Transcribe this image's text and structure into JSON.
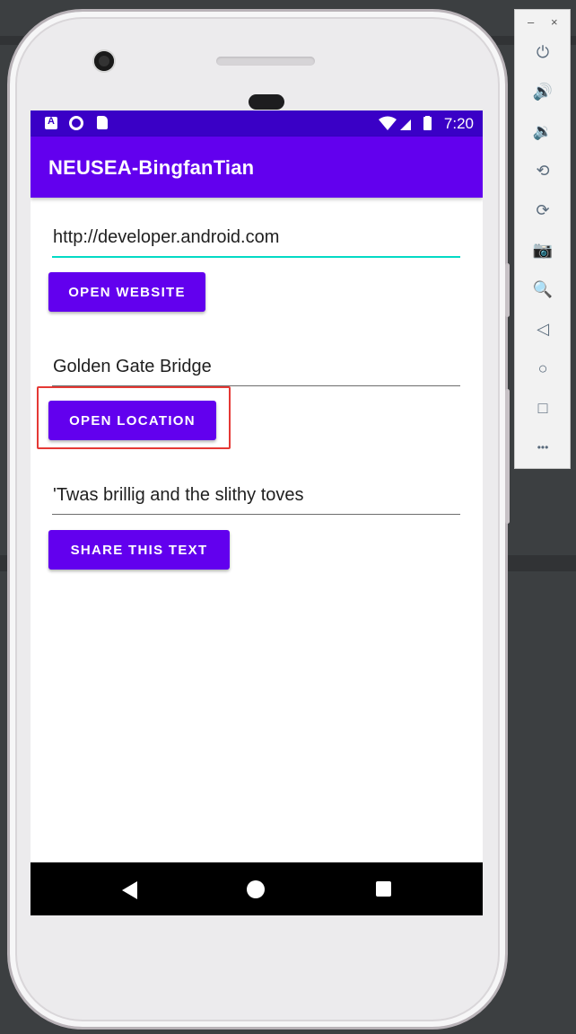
{
  "app": {
    "title": "NEUSEA-BingfanTian"
  },
  "status_bar": {
    "time": "7:20"
  },
  "fields": {
    "website_value": "http://developer.android.com",
    "location_value": "Golden Gate Bridge",
    "share_value": "'Twas brillig and the slithy toves"
  },
  "buttons": {
    "open_website": "OPEN WEBSITE",
    "open_location": "OPEN LOCATION",
    "share_text": "SHARE THIS TEXT"
  },
  "emulator_toolbar": {
    "minimize": "–",
    "close": "×",
    "items": [
      "power-icon",
      "volume-up-icon",
      "volume-down-icon",
      "rotate-left-icon",
      "rotate-right-icon",
      "camera-icon",
      "zoom-icon",
      "back-icon",
      "home-icon",
      "overview-icon",
      "more-icon"
    ],
    "glyphs": [
      "⏻",
      "🔊",
      "🔉",
      "⟲",
      "⟳",
      "📷",
      "🔍",
      "◁",
      "○",
      "□",
      "•••"
    ]
  },
  "colors": {
    "primary": "#6200ee",
    "primary_dark": "#3a00c6",
    "accent": "#03dac5",
    "highlight_box": "#e53935"
  }
}
